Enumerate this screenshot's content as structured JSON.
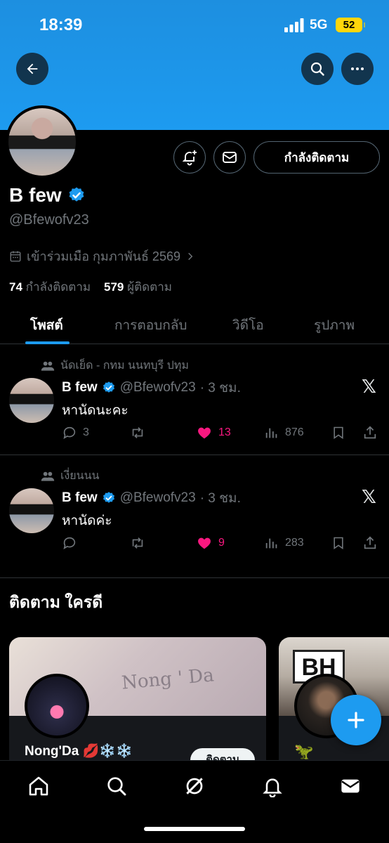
{
  "status_bar": {
    "time": "18:39",
    "network": "5G",
    "battery": "52"
  },
  "header": {
    "back_icon": "arrow-left-icon",
    "search_icon": "search-icon",
    "more_icon": "more-horizontal-icon"
  },
  "profile": {
    "name": "B few",
    "handle": "@Bfewofv23",
    "joined": "เข้าร่วมเมือ กุมภาพันธ์ 2569",
    "following_count": "74",
    "following_label": "กำลังติดตาม",
    "followers_count": "579",
    "followers_label": "ผู้ติดตาม",
    "follow_button": "กำลังติดตาม",
    "verified": true
  },
  "tabs": [
    {
      "label": "โพสต์",
      "active": true
    },
    {
      "label": "การตอบกลับ",
      "active": false
    },
    {
      "label": "วิดีโอ",
      "active": false
    },
    {
      "label": "รูปภาพ",
      "active": false
    }
  ],
  "posts": [
    {
      "context": "นัดเย็ด - กทม นนทบุรี ปทุม",
      "name": "B few",
      "handle": "@Bfewofv23",
      "time": "· 3 ชม.",
      "text": "หานัดนะคะ",
      "replies": "3",
      "reposts": "",
      "likes": "13",
      "views": "876",
      "x_logo": "𝕏"
    },
    {
      "context": "เงี่ยนนน",
      "name": "B few",
      "handle": "@Bfewofv23",
      "time": "· 3 ชม.",
      "text": "หานัดค่ะ",
      "replies": "",
      "reposts": "",
      "likes": "9",
      "views": "283",
      "x_logo": "𝕏"
    }
  ],
  "who_to_follow": {
    "title": "ติดตาม ใครดี",
    "cards": [
      {
        "banner_text": "Nong ' Da",
        "name": "Nong'Da 💋❄️❄️",
        "button": "ติดตาม"
      },
      {
        "banner_text": "BH",
        "name": "🦖"
      }
    ]
  },
  "colors": {
    "accent": "#1d9bf0",
    "like": "#f91880",
    "muted": "#71767b"
  }
}
